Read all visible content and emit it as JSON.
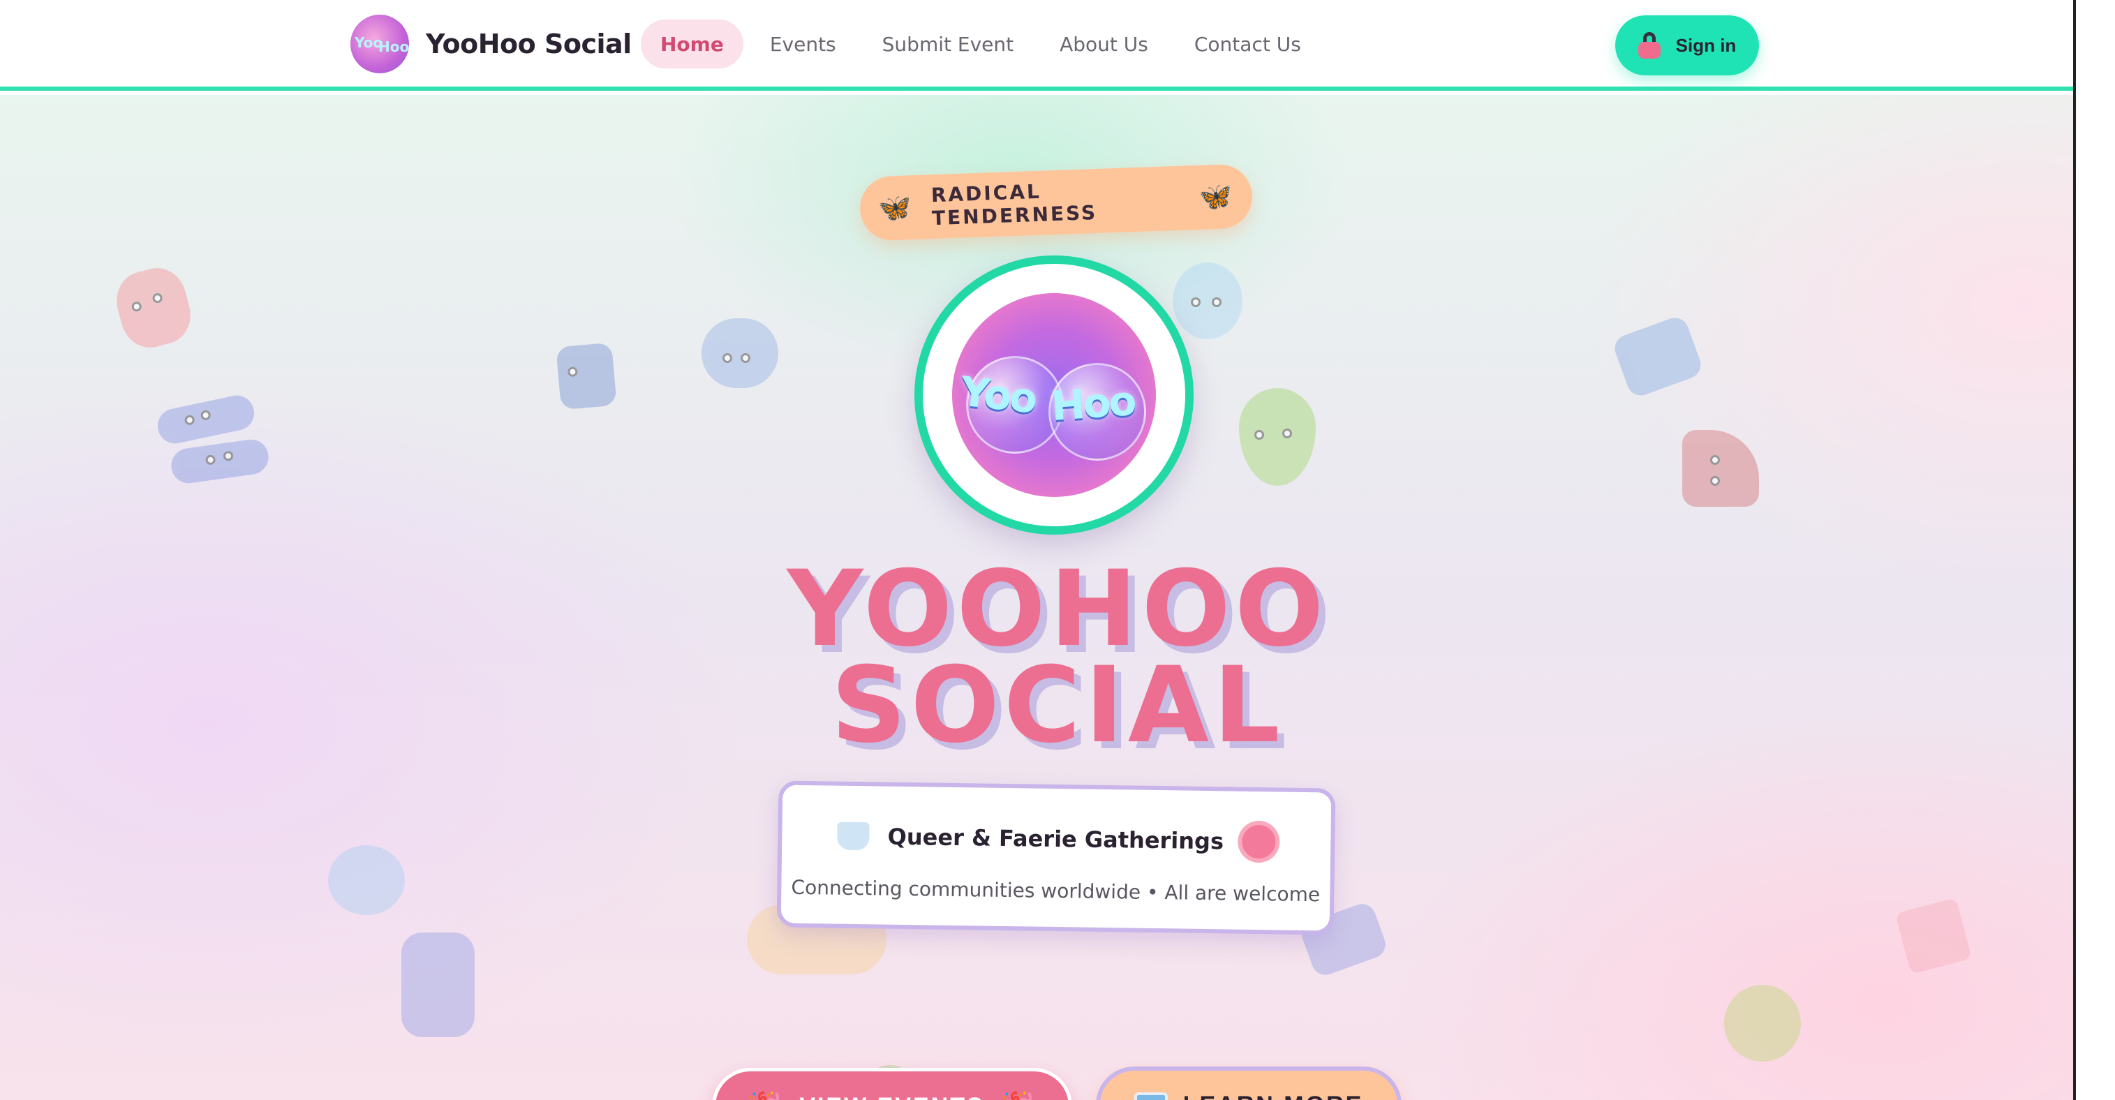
{
  "header": {
    "brand_name": "YooHoo Social",
    "brand_logo_text": [
      "Yoo",
      "Hoo"
    ],
    "nav": [
      {
        "label": "Home",
        "active": true
      },
      {
        "label": "Events",
        "active": false
      },
      {
        "label": "Submit Event",
        "active": false
      },
      {
        "label": "About Us",
        "active": false
      },
      {
        "label": "Contact Us",
        "active": false
      }
    ],
    "signin_label": "Sign in",
    "accent_color": "#1fe3b4"
  },
  "hero": {
    "tag": "RADICAL TENDERNESS",
    "logo_text": [
      "Yoo",
      "Hoo"
    ],
    "title_line1": "YOOHOO",
    "title_line2": "SOCIAL",
    "card_title": "Queer & Faerie Gatherings",
    "card_subtitle": "Connecting communities worldwide • All are welcome",
    "btn_events": "VIEW EVENTS",
    "btn_learn": "LEARN MORE",
    "colors": {
      "title": "#ec6e90",
      "title_shadow": "#c7bde4",
      "tag_bg": "#ffc59a",
      "ring": "#22d9a6"
    }
  },
  "icons": {
    "tag_left": "🦋",
    "tag_right": "🦋",
    "events_left": "🎉",
    "events_right": "🎉"
  }
}
